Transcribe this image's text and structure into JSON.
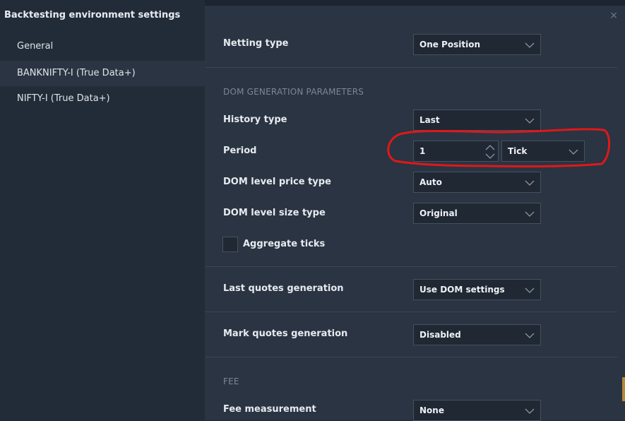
{
  "window": {
    "title": "Backtesting environment settings",
    "close_glyph": "×"
  },
  "sidebar": {
    "items": [
      {
        "label": "General"
      },
      {
        "label": "BANKNIFTY-I (True Data+)"
      },
      {
        "label": "NIFTY-I (True Data+)"
      }
    ],
    "selected_index": 1
  },
  "settings": {
    "netting_type": {
      "label": "Netting type",
      "value": "One Position"
    },
    "dom_section": "DOM GENERATION PARAMETERS",
    "history_type": {
      "label": "History type",
      "value": "Last"
    },
    "period": {
      "label": "Period",
      "value": "1",
      "unit": "Tick"
    },
    "dom_price_type": {
      "label": "DOM level price type",
      "value": "Auto"
    },
    "dom_size_type": {
      "label": "DOM level size type",
      "value": "Original"
    },
    "aggregate_ticks": {
      "label": "Aggregate ticks",
      "checked": false
    },
    "last_quotes": {
      "label": "Last quotes generation",
      "value": "Use DOM settings"
    },
    "mark_quotes": {
      "label": "Mark quotes generation",
      "value": "Disabled"
    },
    "fee_section": "FEE",
    "fee_measurement": {
      "label": "Fee measurement",
      "value": "None"
    }
  },
  "icons": {
    "dropdown": "chevron-down-icon",
    "spinner": "spinner-arrows-icon"
  },
  "colors": {
    "background": "#222c39",
    "panel": "#2a3442",
    "field": "#1f2833",
    "border": "#46515f",
    "annotation": "#e01818"
  }
}
